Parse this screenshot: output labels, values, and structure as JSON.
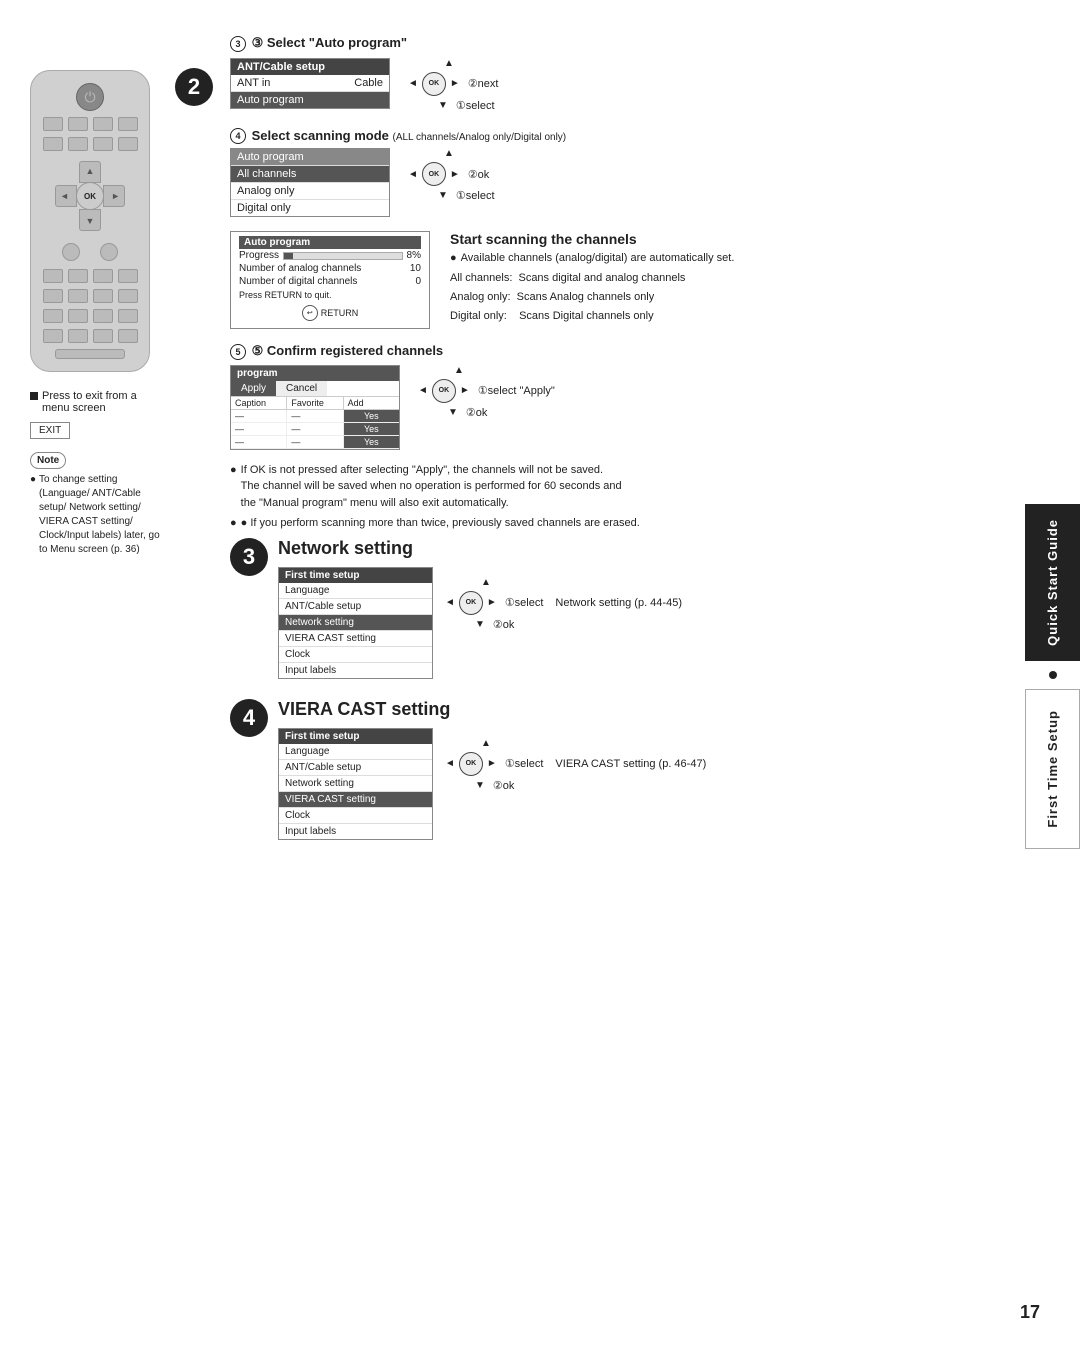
{
  "page": {
    "number": "17",
    "sidebar": {
      "block1": "Quick Start Guide",
      "block2": "First Time Setup"
    }
  },
  "step2": {
    "title": "③ Select \"Auto program\"",
    "menu": {
      "header": "ANT/Cable setup",
      "col1": "ANT in",
      "col2": "Cable",
      "row2": "Auto program"
    },
    "annotations": {
      "next": "②next",
      "select": "①select"
    },
    "step4_title": "④ Select scanning mode",
    "step4_subtitle": "(ALL channels/Analog only/Digital only)",
    "step4_menu": {
      "header": "Auto program",
      "items": [
        "All channels",
        "Analog only",
        "Digital only"
      ]
    },
    "step4_annotations": {
      "ok": "②ok",
      "select": "①select"
    },
    "scan_title": "Start scanning the channels",
    "scan_bullet": "Available channels (analog/digital) are automatically set.",
    "scan_menu": {
      "header": "Auto program",
      "progress_label": "Progress",
      "progress_pct": "8%",
      "analog_label": "Number of analog channels",
      "analog_val": "10",
      "digital_label": "Number of digital channels",
      "digital_val": "0",
      "return_label": "Press RETURN to quit.",
      "return_btn": "RETURN"
    },
    "scan_info": [
      "All channels:  Scans digital and analog channels",
      "Analog only:  Scans Analog channels only",
      "Digital only:   Scans Digital channels only"
    ],
    "step5_title": "⑤ Confirm registered channels",
    "step5_annotations": {
      "select": "①select \"Apply\"",
      "ok": "②ok"
    },
    "prog_table": {
      "header": "program",
      "apply": "Apply",
      "cancel": "Cancel",
      "cols": [
        "Caption",
        "Favorite",
        "Add"
      ],
      "rows": [
        {
          "c": "—",
          "f": "—",
          "a": "Yes"
        },
        {
          "c": "—",
          "f": "—",
          "a": "Yes"
        },
        {
          "c": "—",
          "f": "—",
          "a": "Yes"
        }
      ]
    },
    "note1": "● If OK is not pressed after selecting \"Apply\", the channels will not be saved.\n  The channel will be saved when no operation is performed for 60 seconds and\n  the \"Manual program\" menu will also exit automatically.",
    "note2": "● If you perform scanning more than twice, previously saved channels are erased."
  },
  "step3": {
    "title": "Network setting",
    "press_exit": "■ Press to exit from\n  a menu screen",
    "exit_label": "EXIT",
    "note_title": "Note",
    "note_bullet": "To change setting (Language/ ANT/Cable setup/ Network setting/ VIERA CAST setting/ Clock/Input labels) later, go to Menu screen (p. 36)",
    "menu": {
      "header": "First time setup",
      "items": [
        {
          "label": "Language",
          "active": false
        },
        {
          "label": "ANT/Cable setup",
          "active": false
        },
        {
          "label": "Network setting",
          "active": true
        },
        {
          "label": "VIERA CAST setting",
          "active": false
        },
        {
          "label": "Clock",
          "active": false
        },
        {
          "label": "Input labels",
          "active": false
        }
      ]
    },
    "annotations": {
      "select": "①select",
      "ok": "②ok"
    },
    "ref": "Network setting (p. 44-45)"
  },
  "step4": {
    "title": "VIERA CAST setting",
    "menu": {
      "header": "First time setup",
      "items": [
        {
          "label": "Language",
          "active": false
        },
        {
          "label": "ANT/Cable setup",
          "active": false
        },
        {
          "label": "Network setting",
          "active": false
        },
        {
          "label": "VIERA CAST setting",
          "active": true
        },
        {
          "label": "Clock",
          "active": false
        },
        {
          "label": "Input labels",
          "active": false
        }
      ]
    },
    "annotations": {
      "select": "①select",
      "ok": "②ok"
    },
    "ref": "VIERA CAST setting (p. 46-47)"
  }
}
